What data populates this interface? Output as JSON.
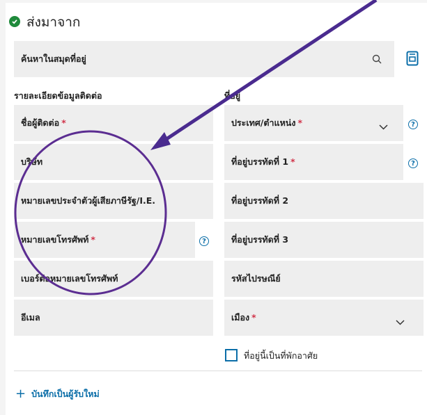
{
  "header": {
    "title": "ส่งมาจาก"
  },
  "search": {
    "placeholder": "ค้นหาในสมุดที่อยู่"
  },
  "sections": {
    "contact": "รายละเอียดข้อมูลติดต่อ",
    "address": "ที่อยู่"
  },
  "contact_fields": [
    {
      "label": "ชื่อผู้ติดต่อ",
      "required": "*"
    },
    {
      "label": "บริษัท"
    },
    {
      "label": "หมายเลขประจำตัวผู้เสียภาษีรัฐ/I.E."
    },
    {
      "label": "หมายเลขโทรศัพท์",
      "required": "*"
    },
    {
      "label": "เบอร์ต่อหมายเลขโทรศัพท์"
    },
    {
      "label": "อีเมล"
    }
  ],
  "address_fields": [
    {
      "label": "ประเทศ/ตำแหน่ง",
      "required": "*"
    },
    {
      "label": "ที่อยู่บรรทัดที่ 1",
      "required": "*"
    },
    {
      "label": "ที่อยู่บรรทัดที่ 2"
    },
    {
      "label": "ที่อยู่บรรทัดที่ 3"
    },
    {
      "label": "รหัสไปรษณีย์"
    },
    {
      "label": "เมือง",
      "required": "*"
    }
  ],
  "help_glyph": "?",
  "residential_checkbox": {
    "label": "ที่อยู่นี้เป็นที่พักอาศัย"
  },
  "save_new_recipient": {
    "label": "บันทึกเป็นผู้รับใหม่",
    "icon": "+"
  },
  "annotation": {
    "arrow_color": "#4a2b8f",
    "circle_color": "#5b2d91"
  },
  "colors": {
    "accent": "#0b6ea8",
    "required": "#d1344a",
    "success": "#1f8a3b",
    "field_bg": "#eeeeee"
  }
}
